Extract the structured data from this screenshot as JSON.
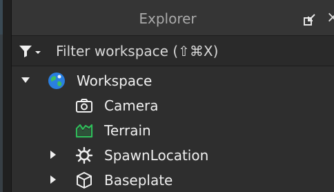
{
  "panel": {
    "title": "Explorer",
    "undock_icon": "undock-arrow-icon",
    "close_label": "×"
  },
  "filter": {
    "icon": "filter-icon",
    "placeholder": "Filter workspace (⇧⌘X)"
  },
  "tree": {
    "items": [
      {
        "label": "Workspace",
        "icon": "globe-icon",
        "expanded": true
      },
      {
        "label": "Camera",
        "icon": "camera-icon"
      },
      {
        "label": "Terrain",
        "icon": "terrain-icon"
      },
      {
        "label": "SpawnLocation",
        "icon": "spawn-gear-icon",
        "expanded": false
      },
      {
        "label": "Baseplate",
        "icon": "cube-icon",
        "expanded": false
      }
    ]
  },
  "colors": {
    "background": "#2e2e2e",
    "titlebar": "#353535",
    "text": "#f0f0f0",
    "terrain_green": "#2fbe5a",
    "globe_blue": "#2a7fe0",
    "globe_green": "#3fbf5f"
  }
}
